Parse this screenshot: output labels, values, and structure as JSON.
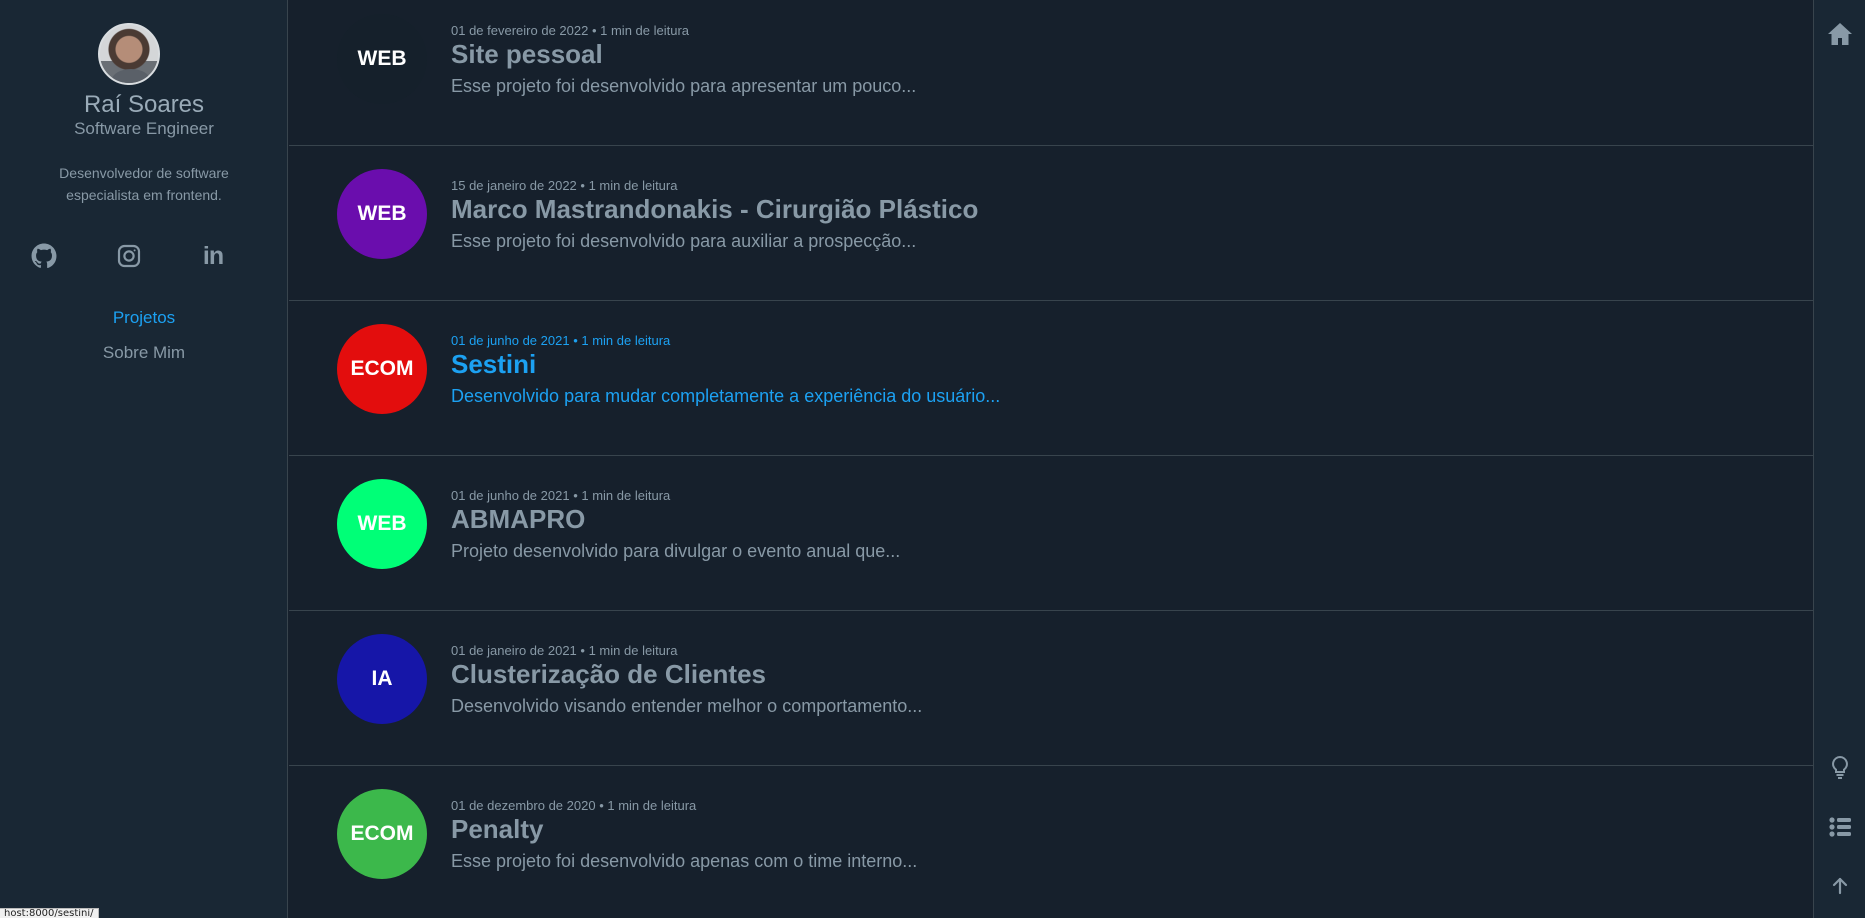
{
  "profile": {
    "name": "Raí Soares",
    "role": "Software Engineer",
    "bio": "Desenvolvedor de software especialista em frontend.",
    "social": [
      {
        "icon": "github-icon"
      },
      {
        "icon": "instagram-icon"
      },
      {
        "icon": "linkedin-icon",
        "glyph": "in"
      }
    ]
  },
  "nav": {
    "projects": "Projetos",
    "about": "Sobre Mim",
    "active": "projects",
    "accent": "#1ca1f2"
  },
  "projects": [
    {
      "tag": "WEB",
      "color": "#15202b",
      "date": "01 de fevereiro de 2022",
      "reading": "1 min de leitura",
      "title": "Site pessoal",
      "desc": "Esse projeto foi desenvolvido para apresentar um pouco..."
    },
    {
      "tag": "WEB",
      "color": "#6a0dad",
      "date": "15 de janeiro de 2022",
      "reading": "1 min de leitura",
      "title": "Marco Mastrandonakis - Cirurgião Plástico",
      "desc": "Esse projeto foi desenvolvido para auxiliar a prospecção..."
    },
    {
      "tag": "ECOM",
      "color": "#e30d0d",
      "date": "01 de junho de 2021",
      "reading": "1 min de leitura",
      "title": "Sestini",
      "desc": "Desenvolvido para mudar completamente a experiência do usuário...",
      "highlighted": true
    },
    {
      "tag": "WEB",
      "color": "#00ff77",
      "date": "01 de junho de 2021",
      "reading": "1 min de leitura",
      "title": "ABMAPRO",
      "desc": "Projeto desenvolvido para divulgar o evento anual que..."
    },
    {
      "tag": "IA",
      "color": "#1616a8",
      "date": "01 de janeiro de 2021",
      "reading": "1 min de leitura",
      "title": "Clusterização de Clientes",
      "desc": "Desenvolvido visando entender melhor o comportamento..."
    },
    {
      "tag": "ECOM",
      "color": "#3cb84b",
      "date": "01 de dezembro de 2020",
      "reading": "1 min de leitura",
      "title": "Penalty",
      "desc": "Esse projeto foi desenvolvido apenas com o time interno..."
    }
  ],
  "separator": "•",
  "rail": {
    "icons": [
      "home-icon",
      "lightbulb-icon",
      "list-icon",
      "arrow-up-icon"
    ]
  },
  "status_url": "host:8000/sestini/"
}
